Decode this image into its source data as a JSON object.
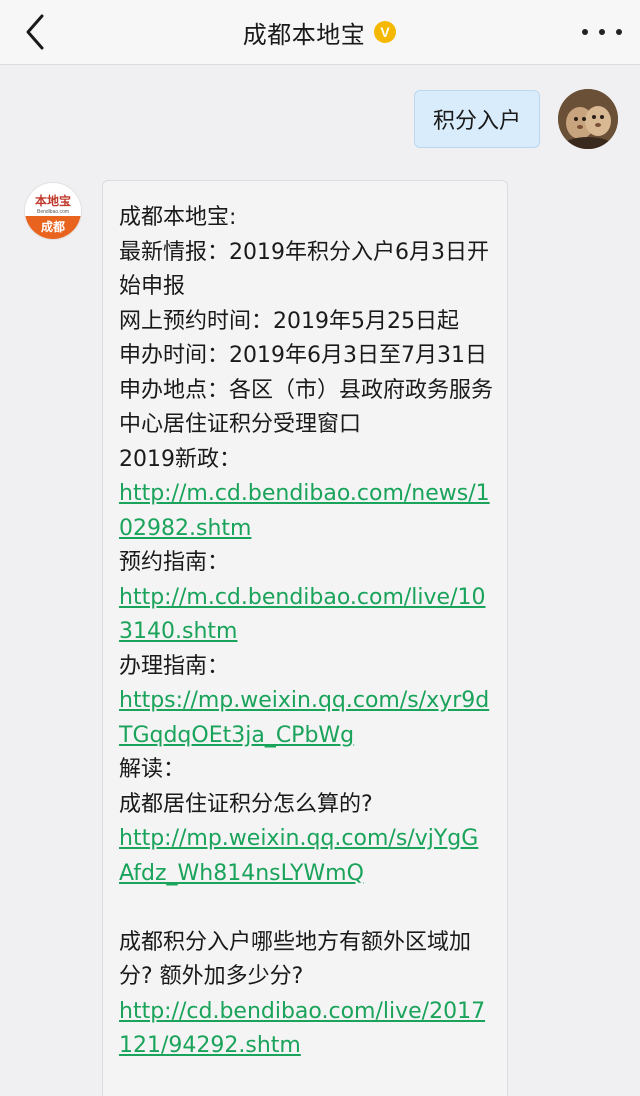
{
  "header": {
    "title": "成都本地宝",
    "back_icon": "chevron-left-icon",
    "verified_icon": "verified-badge-icon",
    "more_icon": "ellipsis-icon"
  },
  "outgoing": {
    "text": "积分入户"
  },
  "bot_avatar": {
    "logo_top": "本地宝",
    "logo_mid": "Bendibao.com",
    "logo_bottom": "成都"
  },
  "incoming": {
    "lines": [
      {
        "text": "成都本地宝:"
      },
      {
        "text": "最新情报：2019年积分入户6月3日开始申报"
      },
      {
        "text": "网上预约时间：2019年5月25日起"
      },
      {
        "text": "申办时间：2019年6月3日至7月31日"
      },
      {
        "text": "申办地点：各区（市）县政府政务服务中心居住证积分受理窗口"
      },
      {
        "text": "2019新政："
      },
      {
        "link": "http://m.cd.bendibao.com/news/102982.shtm"
      },
      {
        "text": "预约指南："
      },
      {
        "link": "http://m.cd.bendibao.com/live/103140.shtm"
      },
      {
        "text": "办理指南："
      },
      {
        "link": "https://mp.weixin.qq.com/s/xyr9dTGqdqOEt3ja_CPbWg"
      },
      {
        "text": "解读："
      },
      {
        "text": "成都居住证积分怎么算的?"
      },
      {
        "link": "http://mp.weixin.qq.com/s/vjYgGAfdz_Wh814nsLYWmQ"
      },
      {
        "spacer": true
      },
      {
        "text": "成都积分入户哪些地方有额外区域加分? 额外加多少分?"
      },
      {
        "link": "http://cd.bendibao.com/live/2017121/94292.shtm"
      }
    ]
  },
  "colors": {
    "link": "#1aa35a",
    "outgoing_bubble": "#d8ecfb",
    "verified": "#f5b800",
    "logo_orange": "#e8641e"
  }
}
